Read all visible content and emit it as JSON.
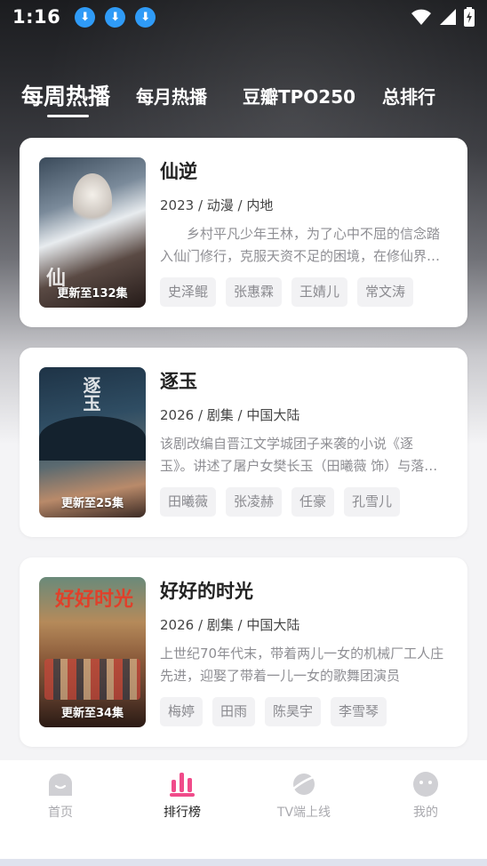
{
  "status_bar": {
    "time": "1:16",
    "download_icons": [
      "download-icon",
      "download-icon",
      "download-icon"
    ]
  },
  "tabs": [
    {
      "label": "每周热播",
      "active": true
    },
    {
      "label": "每月热播",
      "active": false
    },
    {
      "label": "豆瓣TPO250",
      "active": false
    },
    {
      "label": "总排行",
      "active": false
    }
  ],
  "items": [
    {
      "title": "仙逆",
      "meta": "2023 / 动漫 / 内地",
      "description": "　　乡村平凡少年王林，为了心中不屈的信念踏入仙门修行，克服天资不足的困境，在修仙界逐步成长",
      "badge": "更新至132集",
      "poster_art": "仙",
      "tags": [
        "史泽鲲",
        "张惠霖",
        "王婧儿",
        "常文涛"
      ]
    },
    {
      "title": "逐玉",
      "meta": "2026 / 剧集 / 中国大陆",
      "description": "该剧改编自晋江文学城团子来袭的小说《逐玉》。讲述了屠户女樊长玉（田曦薇 饰）与落难侯爷的故事",
      "badge": "更新至25集",
      "poster_art": "逐玉",
      "tags": [
        "田曦薇",
        "张凌赫",
        "任豪",
        "孔雪儿"
      ]
    },
    {
      "title": "好好的时光",
      "meta": "2026 / 剧集 / 中国大陆",
      "description": "上世纪70年代末，带着两儿一女的机械厂工人庄先进，迎娶了带着一儿一女的歌舞团演员",
      "badge": "更新至34集",
      "poster_art": "好好时光",
      "tags": [
        "梅婷",
        "田雨",
        "陈昊宇",
        "李雪琴"
      ]
    }
  ],
  "bottom_nav": [
    {
      "label": "首页",
      "icon": "home-icon",
      "active": false
    },
    {
      "label": "排行榜",
      "icon": "ranking-icon",
      "active": true
    },
    {
      "label": "TV端上线",
      "icon": "tv-planet-icon",
      "active": false
    },
    {
      "label": "我的",
      "icon": "profile-icon",
      "active": false
    }
  ],
  "colors": {
    "accent": "#f04b8a",
    "download_badge": "#2f9bf7",
    "inactive_nav": "#a9a9ae"
  }
}
